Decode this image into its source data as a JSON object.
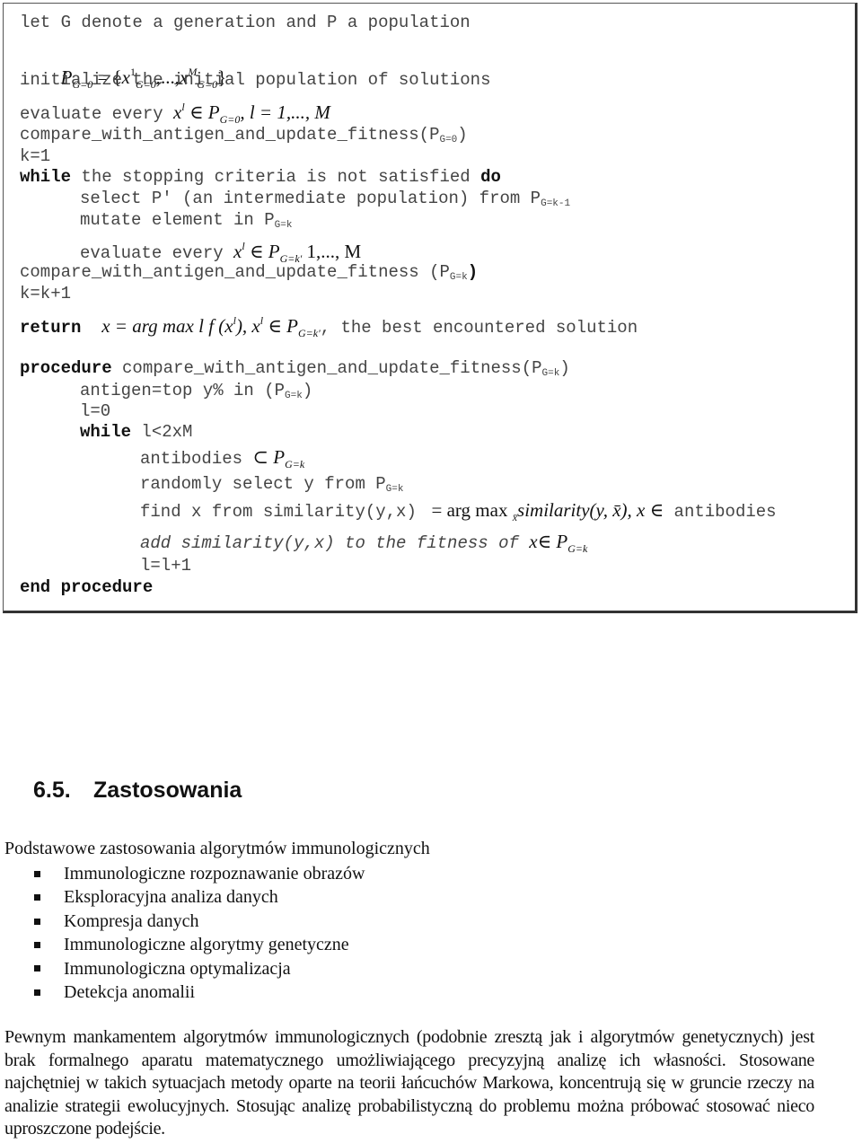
{
  "algorithm": {
    "l1": "let G denote a generation and P a population",
    "l2_math": {
      "lhs": "P",
      "lhs_sub": "G=0",
      "eq": " = {",
      "x1": "x",
      "x1_sup": "1",
      "x1_sub": "G=0",
      "mid": ",...,",
      "xM": "x",
      "xM_sup": "M",
      "xM_sub": "G=0",
      "close": "}"
    },
    "l3": "initialize the initial population of solutions",
    "l4_text": "evaluate every ",
    "l4_math": {
      "x": "x",
      "x_sup": "l",
      "in": " ∈ ",
      "P": "P",
      "P_sub": "G=0",
      "rest": ", l = 1,..., M"
    },
    "l5_text": "compare_with_antigen_and_update_fitness(P",
    "l5_sub": "G=0",
    "l5_close": ")",
    "l6": "k=1",
    "l7_kw": "while",
    "l7_text": " the stopping criteria is not satisfied ",
    "l7_kw2": "do",
    "l8_text": "select P' (an intermediate population) from P",
    "l8_sub": "G=k-1",
    "l9_text": "mutate element in P",
    "l9_sub": "G=k",
    "l10_text": "evaluate every ",
    "l10_math": {
      "x": "x",
      "x_sup": "l",
      "in": " ∈ ",
      "P": "P",
      "P_sub": "G=k'",
      "rest": " 1,..., M"
    },
    "l11_text": "compare_with_antigen_and_update_fitness (P",
    "l11_sub": "G=k",
    "l11_close": ")",
    "l12": "k=k+1",
    "l13_kw": "return",
    "l13_math": {
      "a": "x = arg max l f (x",
      "a_sup": "l",
      "b": "), x",
      "b_sup": "l",
      "in": " ∈ ",
      "P": "P",
      "P_sub": "G=k'"
    },
    "l13_text": ", the best encountered solution",
    "proc_kw": "procedure",
    "proc_text": " compare_with_antigen_and_update_fitness(P",
    "proc_sub": "G=k",
    "proc_close": ")",
    "p1_text": "antigen=top y% in (P",
    "p1_sub": "G=k",
    "p1_close": ")",
    "p2": "l=0",
    "p3_kw": "while",
    "p3_text": " l<2xM",
    "p4_text": "antibodies ",
    "p4_math": {
      "sub": "⊂ ",
      "P": "P",
      "P_sub": "G=k"
    },
    "p5_text": "randomly select y from P",
    "p5_sub": "G=k",
    "p6_text": "find x from similarity(y,x) ",
    "p6_math": {
      "a": " = arg max ",
      "a_sub": "x̄",
      "b": "similarity",
      "c": "(y, x̄), x ∈"
    },
    "p6_tail": " antibodies",
    "p7_text": "add similarity(y,x) to the fitness of ",
    "p7_math": {
      "x": "x",
      "in": "∈ ",
      "P": "P",
      "P_sub": "G=k"
    },
    "p8": "l=l+1",
    "end_kw": "end procedure"
  },
  "section": {
    "number": "6.5.",
    "title": "Zastosowania"
  },
  "intro": "Podstawowe zastosowania algorytmów immunologicznych",
  "applications": [
    "Immunologiczne rozpoznawanie obrazów",
    "Eksploracyjna analiza danych",
    "Kompresja danych",
    "Immunologiczne algorytmy genetyczne",
    "Immunologiczna optymalizacja",
    "Detekcja anomalii"
  ],
  "body_paragraph": "Pewnym mankamentem algorytmów immunologicznych (podobnie zresztą jak i algorytmów genetycznych) jest brak formalnego aparatu matematycznego umożliwiającego precyzyjną analizę ich własności. Stosowane najchętniej w takich sytuacjach metody oparte na teorii łańcuchów Markowa, koncentrują się w gruncie rzeczy na analizie strategii ewolucyjnych. Stosując analizę probabilistyczną do problemu można próbować stosować nieco uproszczone podejście."
}
